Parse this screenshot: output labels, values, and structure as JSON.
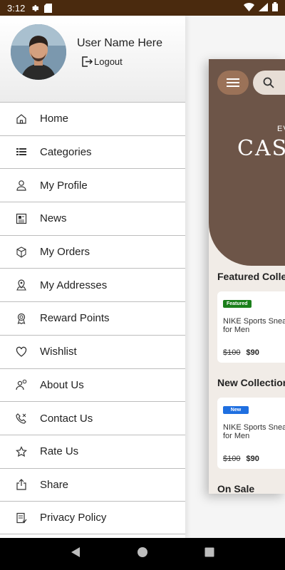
{
  "status_bar": {
    "time": "3:12"
  },
  "drawer": {
    "user_name": "User Name Here",
    "logout_label": "Logout",
    "menu_items": [
      {
        "label": "Home",
        "icon": "home-icon"
      },
      {
        "label": "Categories",
        "icon": "categories-icon"
      },
      {
        "label": "My Profile",
        "icon": "profile-icon"
      },
      {
        "label": "News",
        "icon": "news-icon"
      },
      {
        "label": "My Orders",
        "icon": "orders-icon"
      },
      {
        "label": "My Addresses",
        "icon": "address-icon"
      },
      {
        "label": "Reward Points",
        "icon": "reward-icon"
      },
      {
        "label": "Wishlist",
        "icon": "heart-icon"
      },
      {
        "label": "About Us",
        "icon": "about-icon"
      },
      {
        "label": "Contact Us",
        "icon": "contact-icon"
      },
      {
        "label": "Rate Us",
        "icon": "star-icon"
      },
      {
        "label": "Share",
        "icon": "share-icon"
      },
      {
        "label": "Privacy Policy",
        "icon": "policy-icon"
      }
    ]
  },
  "main": {
    "hero_small": "EV",
    "hero_big": "CAS",
    "sections": {
      "featured": {
        "title": "Featured Collec",
        "badge": "Featured",
        "product_name": "NIKE Sports Sneak for Men",
        "old_price": "$100",
        "price": "$90"
      },
      "new": {
        "title": "New Collection",
        "badge": "New",
        "product_name": "NIKE Sports Sneak for Men",
        "old_price": "$100",
        "price": "$90"
      },
      "sale": {
        "title": "On Sale"
      }
    }
  },
  "colors": {
    "status_bar": "#4a2a0e",
    "hero": "#6d5548",
    "menu_button": "#9b7258",
    "featured_badge": "#1b7f1b",
    "new_badge": "#1f6fe0"
  }
}
